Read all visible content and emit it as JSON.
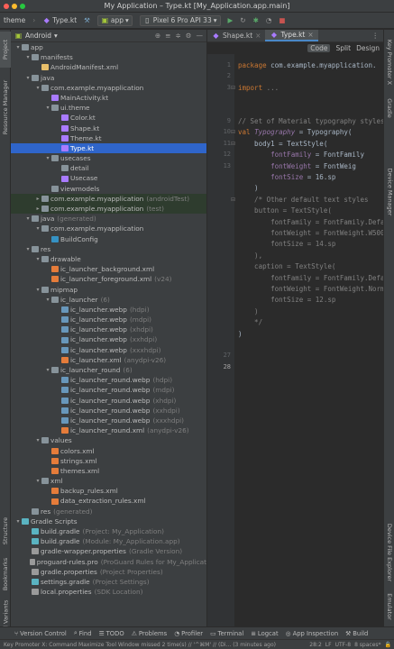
{
  "window": {
    "title": "My Application – Type.kt [My_Application.app.main]"
  },
  "toolbar": {
    "project": "theme",
    "file": "Type.kt",
    "module": "app",
    "device": "Pixel 6 Pro API 33"
  },
  "left_tabs": [
    "Project",
    "Resource Manager",
    "Structure",
    "Bookmarks",
    "Build Variants"
  ],
  "right_tabs": [
    "Key Promoter X",
    "Gradle",
    "Device Manager",
    "Device File Explorer",
    "Emulator"
  ],
  "project_panel": {
    "view": "Android",
    "tree": [
      {
        "d": 0,
        "arr": "▾",
        "icon": "folder",
        "label": "app",
        "extra": ""
      },
      {
        "d": 1,
        "arr": "▾",
        "icon": "folder",
        "label": "manifests",
        "extra": ""
      },
      {
        "d": 2,
        "arr": "",
        "icon": "manifest",
        "label": "AndroidManifest.xml",
        "extra": ""
      },
      {
        "d": 1,
        "arr": "▾",
        "icon": "folder",
        "label": "java",
        "extra": ""
      },
      {
        "d": 2,
        "arr": "▾",
        "icon": "package",
        "label": "com.example.myapplication",
        "extra": ""
      },
      {
        "d": 3,
        "arr": "",
        "icon": "kotlin",
        "label": "MainActivity.kt",
        "extra": ""
      },
      {
        "d": 3,
        "arr": "▾",
        "icon": "package",
        "label": "ui.theme",
        "extra": ""
      },
      {
        "d": 4,
        "arr": "",
        "icon": "kotlin",
        "label": "Color.kt",
        "extra": ""
      },
      {
        "d": 4,
        "arr": "",
        "icon": "kotlin",
        "label": "Shape.kt",
        "extra": ""
      },
      {
        "d": 4,
        "arr": "",
        "icon": "kotlin",
        "label": "Theme.kt",
        "extra": ""
      },
      {
        "d": 4,
        "arr": "",
        "icon": "kotlin",
        "label": "Type.kt",
        "extra": "",
        "sel": true
      },
      {
        "d": 3,
        "arr": "▾",
        "icon": "package",
        "label": "usecases",
        "extra": ""
      },
      {
        "d": 4,
        "arr": "",
        "icon": "package",
        "label": "detail",
        "extra": ""
      },
      {
        "d": 4,
        "arr": "",
        "icon": "kotlin",
        "label": "Usecase",
        "extra": ""
      },
      {
        "d": 3,
        "arr": "",
        "icon": "package",
        "label": "viewmodels",
        "extra": ""
      },
      {
        "d": 2,
        "arr": "▸",
        "icon": "package",
        "label": "com.example.myapplication",
        "extra": "(androidTest)",
        "green": true
      },
      {
        "d": 2,
        "arr": "▸",
        "icon": "package",
        "label": "com.example.myapplication",
        "extra": "(test)",
        "green": true
      },
      {
        "d": 1,
        "arr": "▾",
        "icon": "folder",
        "label": "java",
        "extra": "(generated)"
      },
      {
        "d": 2,
        "arr": "▾",
        "icon": "package",
        "label": "com.example.myapplication",
        "extra": ""
      },
      {
        "d": 3,
        "arr": "",
        "icon": "java",
        "label": "BuildConfig",
        "extra": ""
      },
      {
        "d": 1,
        "arr": "▾",
        "icon": "folder",
        "label": "res",
        "extra": ""
      },
      {
        "d": 2,
        "arr": "▾",
        "icon": "folder",
        "label": "drawable",
        "extra": ""
      },
      {
        "d": 3,
        "arr": "",
        "icon": "xml",
        "label": "ic_launcher_background.xml",
        "extra": ""
      },
      {
        "d": 3,
        "arr": "",
        "icon": "xml",
        "label": "ic_launcher_foreground.xml",
        "extra": "(v24)"
      },
      {
        "d": 2,
        "arr": "▾",
        "icon": "folder",
        "label": "mipmap",
        "extra": ""
      },
      {
        "d": 3,
        "arr": "▾",
        "icon": "folder",
        "label": "ic_launcher",
        "extra": "(6)"
      },
      {
        "d": 4,
        "arr": "",
        "icon": "image",
        "label": "ic_launcher.webp",
        "extra": "(hdpi)"
      },
      {
        "d": 4,
        "arr": "",
        "icon": "image",
        "label": "ic_launcher.webp",
        "extra": "(mdpi)"
      },
      {
        "d": 4,
        "arr": "",
        "icon": "image",
        "label": "ic_launcher.webp",
        "extra": "(xhdpi)"
      },
      {
        "d": 4,
        "arr": "",
        "icon": "image",
        "label": "ic_launcher.webp",
        "extra": "(xxhdpi)"
      },
      {
        "d": 4,
        "arr": "",
        "icon": "image",
        "label": "ic_launcher.webp",
        "extra": "(xxxhdpi)"
      },
      {
        "d": 4,
        "arr": "",
        "icon": "xml",
        "label": "ic_launcher.xml",
        "extra": "(anydpi-v26)"
      },
      {
        "d": 3,
        "arr": "▾",
        "icon": "folder",
        "label": "ic_launcher_round",
        "extra": "(6)"
      },
      {
        "d": 4,
        "arr": "",
        "icon": "image",
        "label": "ic_launcher_round.webp",
        "extra": "(hdpi)"
      },
      {
        "d": 4,
        "arr": "",
        "icon": "image",
        "label": "ic_launcher_round.webp",
        "extra": "(mdpi)"
      },
      {
        "d": 4,
        "arr": "",
        "icon": "image",
        "label": "ic_launcher_round.webp",
        "extra": "(xhdpi)"
      },
      {
        "d": 4,
        "arr": "",
        "icon": "image",
        "label": "ic_launcher_round.webp",
        "extra": "(xxhdpi)"
      },
      {
        "d": 4,
        "arr": "",
        "icon": "image",
        "label": "ic_launcher_round.webp",
        "extra": "(xxxhdpi)"
      },
      {
        "d": 4,
        "arr": "",
        "icon": "xml",
        "label": "ic_launcher_round.xml",
        "extra": "(anydpi-v26)"
      },
      {
        "d": 2,
        "arr": "▾",
        "icon": "folder",
        "label": "values",
        "extra": ""
      },
      {
        "d": 3,
        "arr": "",
        "icon": "xml",
        "label": "colors.xml",
        "extra": ""
      },
      {
        "d": 3,
        "arr": "",
        "icon": "xml",
        "label": "strings.xml",
        "extra": ""
      },
      {
        "d": 3,
        "arr": "",
        "icon": "xml",
        "label": "themes.xml",
        "extra": ""
      },
      {
        "d": 2,
        "arr": "▾",
        "icon": "folder",
        "label": "xml",
        "extra": ""
      },
      {
        "d": 3,
        "arr": "",
        "icon": "xml",
        "label": "backup_rules.xml",
        "extra": ""
      },
      {
        "d": 3,
        "arr": "",
        "icon": "xml",
        "label": "data_extraction_rules.xml",
        "extra": ""
      },
      {
        "d": 1,
        "arr": "",
        "icon": "folder",
        "label": "res",
        "extra": "(generated)"
      },
      {
        "d": 0,
        "arr": "▾",
        "icon": "gradle",
        "label": "Gradle Scripts",
        "extra": ""
      },
      {
        "d": 1,
        "arr": "",
        "icon": "gradle",
        "label": "build.gradle",
        "extra": "(Project: My_Application)"
      },
      {
        "d": 1,
        "arr": "",
        "icon": "gradle",
        "label": "build.gradle",
        "extra": "(Module: My_Application.app)"
      },
      {
        "d": 1,
        "arr": "",
        "icon": "props",
        "label": "gradle-wrapper.properties",
        "extra": "(Gradle Version)"
      },
      {
        "d": 1,
        "arr": "",
        "icon": "props",
        "label": "proguard-rules.pro",
        "extra": "(ProGuard Rules for My_Applicat"
      },
      {
        "d": 1,
        "arr": "",
        "icon": "props",
        "label": "gradle.properties",
        "extra": "(Project Properties)"
      },
      {
        "d": 1,
        "arr": "",
        "icon": "gradle",
        "label": "settings.gradle",
        "extra": "(Project Settings)"
      },
      {
        "d": 1,
        "arr": "",
        "icon": "props",
        "label": "local.properties",
        "extra": "(SDK Location)"
      }
    ]
  },
  "editor": {
    "tabs": [
      {
        "label": "Shape.kt",
        "active": false
      },
      {
        "label": "Type.kt",
        "active": true
      }
    ],
    "modes": [
      "Code",
      "Split",
      "Design"
    ],
    "line_numbers": [
      "1",
      "2",
      "3",
      "",
      "",
      "9",
      "10",
      "11",
      "12",
      "13",
      "",
      "",
      "",
      "",
      "",
      "",
      "",
      "",
      "",
      "",
      "",
      "",
      "",
      "",
      "",
      "",
      "27",
      "28"
    ],
    "lines": [
      [
        {
          "t": "package ",
          "c": "kw"
        },
        {
          "t": "com.example.myapplication.",
          "c": ""
        }
      ],
      [],
      [
        {
          "t": "import ",
          "c": "kw"
        },
        {
          "t": "...",
          "c": "cm"
        }
      ],
      [],
      [],
      [
        {
          "t": "// Set of Material typography styles",
          "c": "cm"
        }
      ],
      [
        {
          "t": "val ",
          "c": "kw"
        },
        {
          "t": "Typography",
          "c": "it"
        },
        {
          "t": " = Typography(",
          "c": ""
        }
      ],
      [
        {
          "t": "    body1 = TextStyle(",
          "c": ""
        }
      ],
      [
        {
          "t": "        fontFamily",
          "c": "prop"
        },
        {
          "t": " = FontFamily",
          "c": ""
        }
      ],
      [
        {
          "t": "        fontWeight",
          "c": "prop"
        },
        {
          "t": " = FontWeig",
          "c": ""
        }
      ],
      [
        {
          "t": "        fontSize",
          "c": "prop"
        },
        {
          "t": " = 16.sp",
          "c": ""
        }
      ],
      [
        {
          "t": "    )",
          "c": ""
        }
      ],
      [
        {
          "t": "    /* Other default text styles",
          "c": "cm"
        }
      ],
      [
        {
          "t": "    button = TextStyle(",
          "c": "cm"
        }
      ],
      [
        {
          "t": "        fontFamily = FontFamily.Defau",
          "c": "cm"
        }
      ],
      [
        {
          "t": "        fontWeight = FontWeight.W500,",
          "c": "cm"
        }
      ],
      [
        {
          "t": "        fontSize = 14.sp",
          "c": "cm"
        }
      ],
      [
        {
          "t": "    ),",
          "c": "cm"
        }
      ],
      [
        {
          "t": "    caption = TextStyle(",
          "c": "cm"
        }
      ],
      [
        {
          "t": "        fontFamily = FontFamily.Defau",
          "c": "cm"
        }
      ],
      [
        {
          "t": "        fontWeight = FontWeight.Norma",
          "c": "cm"
        }
      ],
      [
        {
          "t": "        fontSize = 12.sp",
          "c": "cm"
        }
      ],
      [
        {
          "t": "    )",
          "c": "cm"
        }
      ],
      [
        {
          "t": "    */",
          "c": "cm"
        }
      ],
      [
        {
          "t": ")",
          "c": ""
        }
      ]
    ]
  },
  "bottom_tools": [
    "Version Control",
    "Find",
    "TODO",
    "Problems",
    "Profiler",
    "Terminal",
    "Logcat",
    "App Inspection",
    "Build"
  ],
  "status": {
    "message": "Key Promoter X: Command Maximize Tool Window missed 2 time(s) // '^⌘M' // (Di... (3 minutes ago)",
    "position": "28:2",
    "line_sep": "LF",
    "encoding": "UTF-8",
    "indent": "8 spaces*"
  },
  "colors": {
    "accent": "#2f65ca",
    "tab_underline": "#4a88c7",
    "keyword": "#cc7832",
    "comment": "#808080",
    "property": "#9876aa"
  }
}
